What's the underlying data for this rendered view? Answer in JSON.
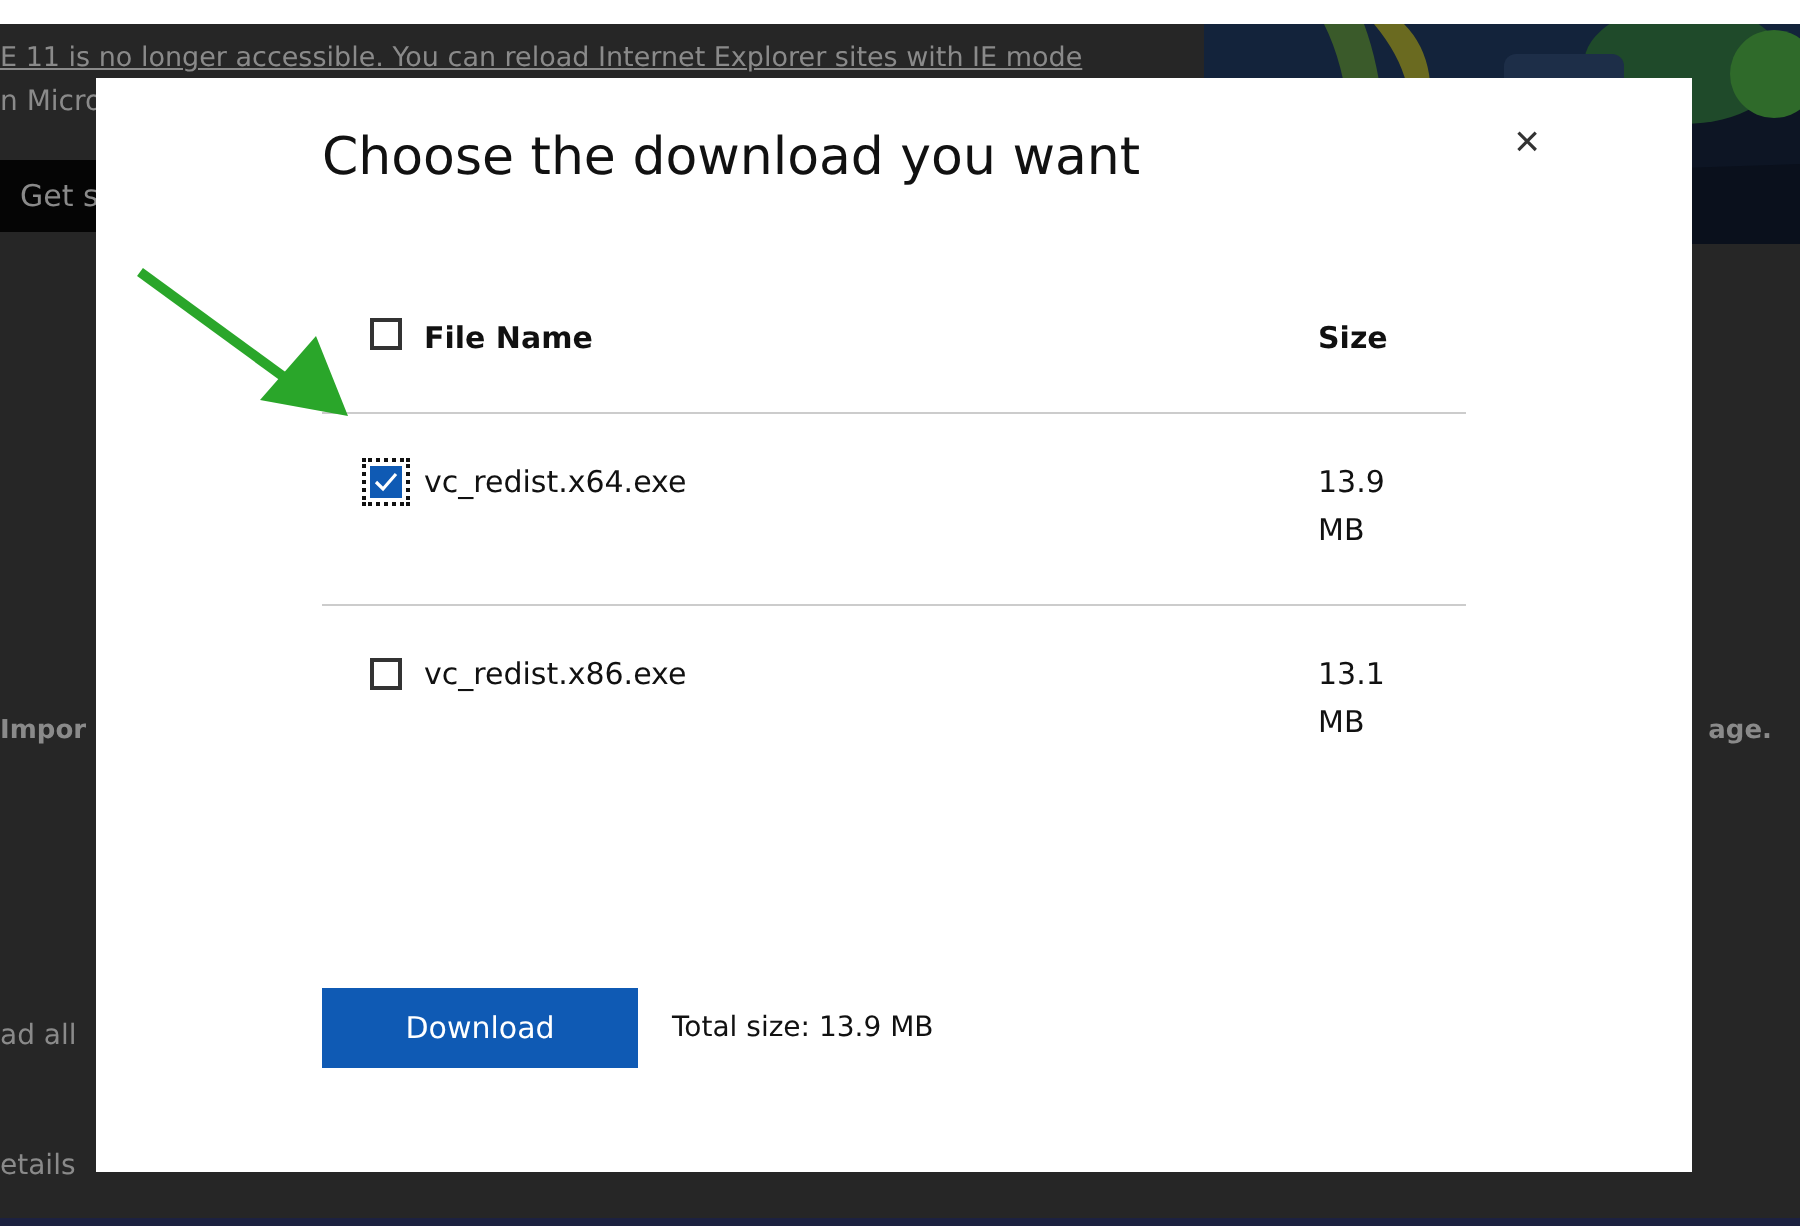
{
  "background_page": {
    "notice_lines": [
      "E 11 is no longer accessible. You can reload Internet Explorer sites with IE mode",
      "n Micro"
    ],
    "get_button": "Get s",
    "important_text": "Impor",
    "page_text": "age.",
    "link_text": "ad all",
    "details_text": "etails"
  },
  "dialog": {
    "title": "Choose the download you want",
    "close": "×",
    "header": {
      "select_all_checked": false,
      "file_name": "File Name",
      "size": "Size"
    },
    "files": [
      {
        "name": "vc_redist.x64.exe",
        "size": "13.9 MB",
        "checked": true,
        "focused": true
      },
      {
        "name": "vc_redist.x86.exe",
        "size": "13.1 MB",
        "checked": false,
        "focused": false
      }
    ],
    "download_button": "Download",
    "total": "Total size: 13.9 MB"
  }
}
